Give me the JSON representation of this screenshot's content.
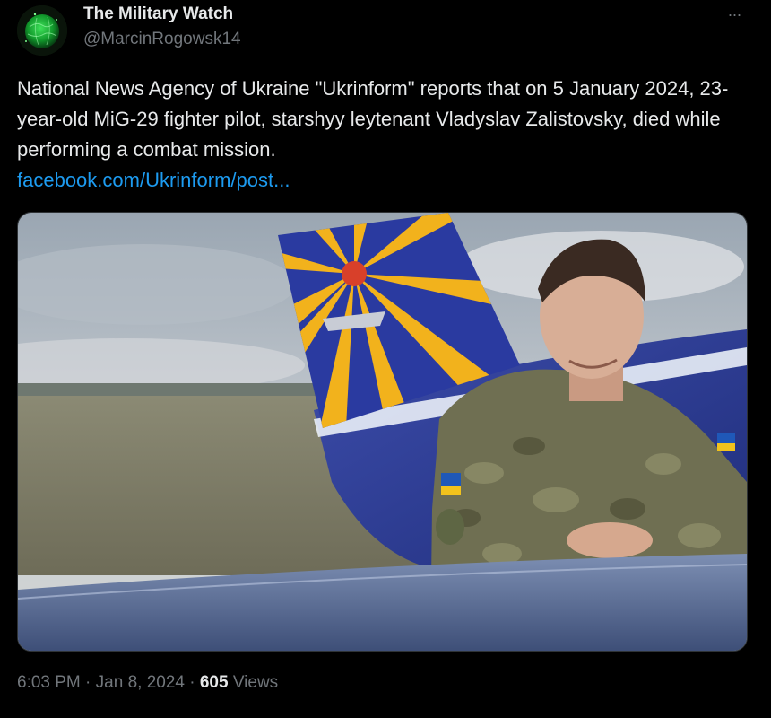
{
  "author": {
    "name": "The Military Watch",
    "handle": "@MarcinRogowsk14"
  },
  "menu": {
    "more_label": "···"
  },
  "tweet": {
    "text": "National News Agency of Ukraine \"Ukrinform\" reports that on 5 January 2024, 23-year-old MiG-29 fighter pilot, starshyy leytenant Vladyslav Zalistovsky, died while performing a combat mission.",
    "link": "facebook.com/Ukrinform/post..."
  },
  "meta": {
    "time": "6:03 PM",
    "separator": "·",
    "date": "Jan 8, 2024",
    "views_count": "605",
    "views_label": "Views"
  },
  "colors": {
    "background": "#000000",
    "text": "#e7e9ea",
    "secondary": "#71767b",
    "link": "#1d9bf0"
  },
  "icons": {
    "avatar": "globe-avatar",
    "more": "more-horizontal-icon"
  }
}
